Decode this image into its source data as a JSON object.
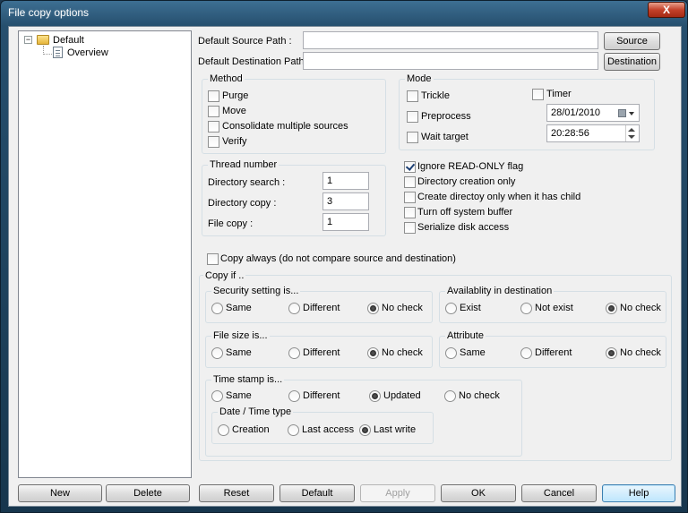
{
  "window": {
    "title": "File copy options",
    "close_glyph": "X"
  },
  "tree": {
    "root_label": "Default",
    "child_label": "Overview",
    "expander_glyph": "⊟"
  },
  "paths": {
    "source_label": "Default Source Path :",
    "source_value": "",
    "source_button": "Source",
    "dest_label": "Default Destination Path :",
    "dest_value": "",
    "dest_button": "Destination"
  },
  "method": {
    "title": "Method",
    "items": [
      {
        "label": "Purge",
        "checked": false
      },
      {
        "label": "Move",
        "checked": false
      },
      {
        "label": "Consolidate multiple sources",
        "checked": false
      },
      {
        "label": "Verify",
        "checked": false
      }
    ]
  },
  "mode": {
    "title": "Mode",
    "trickle": "Trickle",
    "timer": "Timer",
    "preprocess": "Preprocess",
    "wait_target": "Wait target",
    "date_value": "28/01/2010",
    "time_value": "20:28:56"
  },
  "thread": {
    "title": "Thread number",
    "dir_search_label": "Directory search :",
    "dir_search_value": "1",
    "dir_copy_label": "Directory copy :",
    "dir_copy_value": "3",
    "file_copy_label": "File copy :",
    "file_copy_value": "1"
  },
  "flags": [
    {
      "label": "Ignore READ-ONLY flag",
      "checked": true
    },
    {
      "label": "Directory creation only",
      "checked": false
    },
    {
      "label": "Create directoy only when it has child",
      "checked": false
    },
    {
      "label": "Turn off system buffer",
      "checked": false
    },
    {
      "label": "Serialize disk access",
      "checked": false
    }
  ],
  "copy_always": {
    "label": "Copy always (do not compare source and destination)",
    "checked": false
  },
  "copy_if": {
    "title": "Copy if ..",
    "security": {
      "title": "Security setting is...",
      "options": [
        "Same",
        "Different",
        "No check"
      ],
      "selected": 2
    },
    "availability": {
      "title": "Availablity in destination",
      "options": [
        "Exist",
        "Not exist",
        "No check"
      ],
      "selected": 2
    },
    "filesize": {
      "title": "File size is...",
      "options": [
        "Same",
        "Different",
        "No check"
      ],
      "selected": 2
    },
    "attribute": {
      "title": "Attribute",
      "options": [
        "Same",
        "Different",
        "No check"
      ],
      "selected": 2
    },
    "timestamp": {
      "title": "Time stamp is...",
      "options": [
        "Same",
        "Different",
        "Updated",
        "No check"
      ],
      "selected": 2
    },
    "datetime": {
      "title": "Date / Time type",
      "options": [
        "Creation",
        "Last access",
        "Last write"
      ],
      "selected": 2
    }
  },
  "buttons": {
    "new": "New",
    "delete": "Delete",
    "reset": "Reset",
    "default": "Default",
    "apply": "Apply",
    "ok": "OK",
    "cancel": "Cancel",
    "help": "Help"
  }
}
